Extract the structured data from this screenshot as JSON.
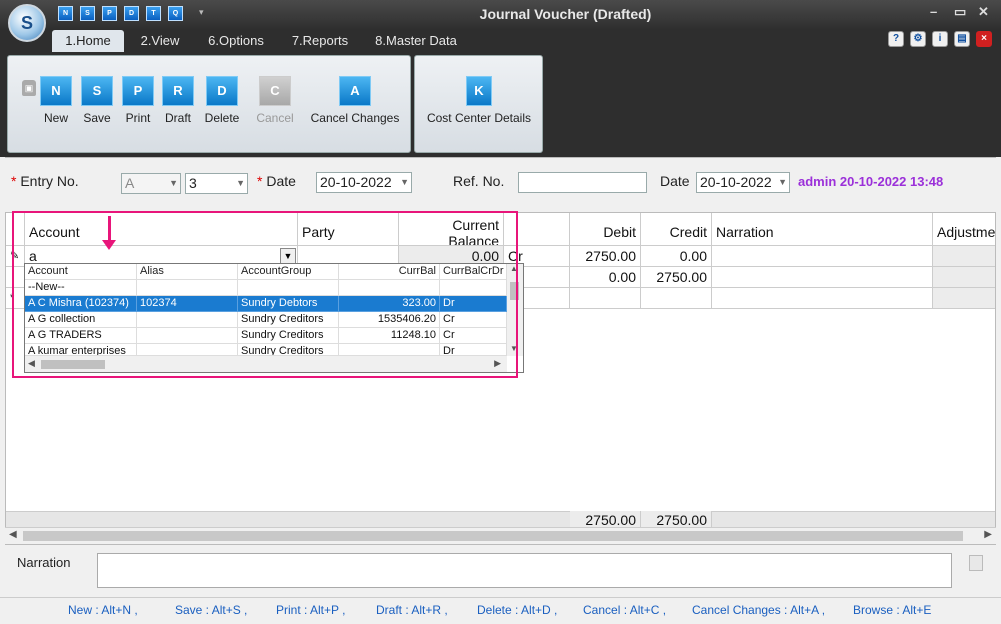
{
  "window": {
    "title": "Journal Voucher (Drafted)"
  },
  "quick_access": [
    "N",
    "S",
    "P",
    "D",
    "T",
    "Q"
  ],
  "tabs": [
    "1.Home",
    "2.View",
    "6.Options",
    "7.Reports",
    "8.Master Data"
  ],
  "toolbar": {
    "buttons": [
      {
        "label": "New",
        "glyph": "N"
      },
      {
        "label": "Save",
        "glyph": "S"
      },
      {
        "label": "Print",
        "glyph": "P"
      },
      {
        "label": "Draft",
        "glyph": "R"
      },
      {
        "label": "Delete",
        "glyph": "D"
      },
      {
        "label": "Cancel",
        "glyph": "C"
      },
      {
        "label": "Cancel Changes",
        "glyph": "A"
      }
    ],
    "cost_center": {
      "label": "Cost Center Details",
      "glyph": "K"
    }
  },
  "form": {
    "entry_no_label": "Entry No.",
    "entry_prefix": "A",
    "entry_number": "3",
    "date_label": "Date",
    "date_value": "20-10-2022",
    "ref_no_label": "Ref. No.",
    "ref_no_value": "",
    "date2_label": "Date",
    "date2_value": "20-10-2022",
    "admin_info": "admin 20-10-2022 13:48"
  },
  "grid": {
    "columns": {
      "account": "Account",
      "party": "Party",
      "balance": "Current Balance",
      "debit": "Debit",
      "credit": "Credit",
      "narration": "Narration",
      "adjustment": "Adjustme"
    },
    "rows": [
      {
        "account": "a",
        "balance": "0.00",
        "crdr": "Cr",
        "debit": "2750.00",
        "credit": "0.00"
      },
      {
        "debit": "0.00",
        "credit": "2750.00"
      }
    ],
    "totals": {
      "debit": "2750.00",
      "credit": "2750.00"
    }
  },
  "popup": {
    "headers": [
      "Account",
      "Alias",
      "AccountGroup",
      "CurrBal",
      "CurrBalCrDr"
    ],
    "rows": [
      {
        "account": "--New--",
        "alias": "",
        "group": "",
        "bal": "",
        "crdr": ""
      },
      {
        "account": "A C Mishra (102374)",
        "alias": "102374",
        "group": "Sundry Debtors",
        "bal": "323.00",
        "crdr": "Dr"
      },
      {
        "account": "A G collection",
        "alias": "",
        "group": "Sundry Creditors",
        "bal": "1535406.20",
        "crdr": "Cr"
      },
      {
        "account": "A G TRADERS",
        "alias": "",
        "group": "Sundry Creditors",
        "bal": "11248.10",
        "crdr": "Cr"
      },
      {
        "account": "A kumar enterprises",
        "alias": "",
        "group": "Sundry Creditors",
        "bal": "",
        "crdr": "Dr"
      }
    ]
  },
  "narration": {
    "label": "Narration",
    "value": ""
  },
  "shortcuts": [
    "New : Alt+N ,",
    "Save : Alt+S ,",
    "Print : Alt+P ,",
    "Draft : Alt+R ,",
    "Delete : Alt+D ,",
    "Cancel : Alt+C ,",
    "Cancel Changes : Alt+A ,",
    "Browse : Alt+E"
  ],
  "colors": {
    "accent": "#1a7bd0",
    "highlight": "#e8157a",
    "admin": "#9b30d9"
  }
}
